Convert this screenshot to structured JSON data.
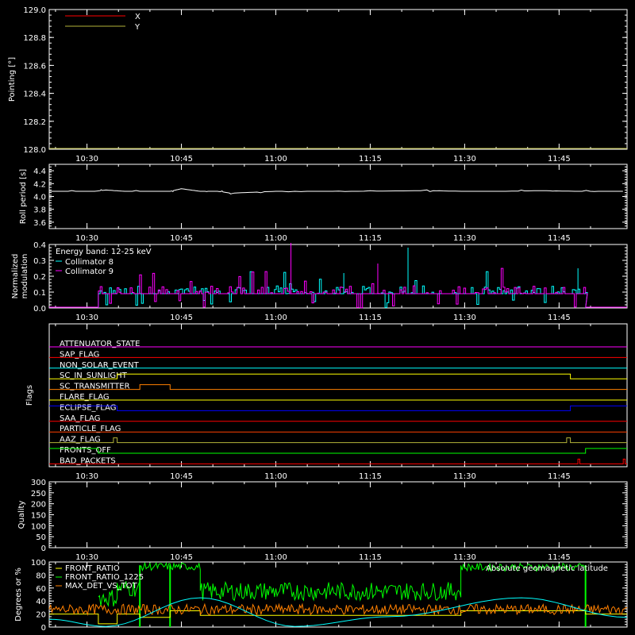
{
  "figure": {
    "background": "#000000",
    "axis_color": "#ffffff",
    "time_ticks": [
      "10:30",
      "10:45",
      "11:00",
      "11:15",
      "11:30",
      "11:45"
    ],
    "time_range_minutes": [
      10.4,
      11.93
    ],
    "time_tick_positions": [
      10.5,
      10.75,
      11.0,
      11.25,
      11.5,
      11.75
    ]
  },
  "chart_data": [
    {
      "id": "pointing",
      "type": "line",
      "ylabel": "Pointing [°]",
      "ylim": [
        128.0,
        129.0
      ],
      "yticks": [
        "128.0",
        "128.2",
        "128.4",
        "128.6",
        "128.8",
        "129.0"
      ],
      "ytick_values": [
        128.0,
        128.2,
        128.4,
        128.6,
        128.8,
        129.0
      ],
      "legend": [
        {
          "label": "X",
          "color": "#ff0000"
        },
        {
          "label": "Y",
          "color": "#b5b53a"
        }
      ],
      "series": [
        {
          "name": "X",
          "color": "#ff0000",
          "x": [
            10.4,
            11.93
          ],
          "y": [
            null,
            null
          ]
        },
        {
          "name": "Y",
          "color": "#b5b53a",
          "x": [
            10.4,
            11.93
          ],
          "y": [
            128.0,
            128.0
          ]
        }
      ]
    },
    {
      "id": "roll",
      "type": "line",
      "ylabel": "Roll period [s]",
      "ylim": [
        3.5,
        4.5
      ],
      "yticks": [
        "3.6",
        "3.8",
        "4.0",
        "4.2",
        "4.4"
      ],
      "ytick_values": [
        3.6,
        3.8,
        4.0,
        4.2,
        4.4
      ],
      "series": [
        {
          "name": "",
          "color": "#ffffff",
          "x": [
            10.4,
            10.52,
            10.55,
            10.6,
            10.72,
            10.75,
            10.8,
            10.85,
            10.88,
            11.0,
            11.2,
            11.4,
            11.5,
            11.6,
            11.7,
            11.8,
            11.93
          ],
          "y": [
            4.08,
            4.08,
            4.1,
            4.08,
            4.08,
            4.12,
            4.08,
            4.08,
            4.05,
            4.08,
            4.08,
            4.09,
            4.08,
            4.08,
            4.09,
            4.08,
            4.08
          ]
        }
      ]
    },
    {
      "id": "modulation",
      "type": "line",
      "ylabel": "Normalized modulation",
      "ylim": [
        0.0,
        0.4
      ],
      "yticks": [
        "0.0",
        "0.1",
        "0.2",
        "0.3",
        "0.4"
      ],
      "ytick_values": [
        0.0,
        0.1,
        0.2,
        0.3,
        0.4
      ],
      "annotation": "Energy band: 12-25 keV",
      "legend": [
        {
          "label": "Collimator 8",
          "color": "#00ffff"
        },
        {
          "label": "Collimator 9",
          "color": "#ff00ff"
        }
      ],
      "active_range": [
        10.53,
        11.82
      ],
      "baseline": 0.09,
      "series": [
        {
          "name": "Collimator 8",
          "color": "#00ffff"
        },
        {
          "name": "Collimator 9",
          "color": "#ff00ff"
        }
      ]
    },
    {
      "id": "flags",
      "type": "line",
      "ylabel": "Flags",
      "flags": [
        {
          "label": "ATTENUATOR_STATE",
          "color": "#ff00ff",
          "transitions": []
        },
        {
          "label": "SAP_FLAG",
          "color": "#ff0000",
          "transitions": []
        },
        {
          "label": "NON_SOLAR_EVENT",
          "color": "#00ffff",
          "transitions": []
        },
        {
          "label": "SC_IN_SUNLIGHT",
          "color": "#ffff00",
          "transitions": [
            [
              10.4,
              0
            ],
            [
              10.58,
              1
            ],
            [
              11.78,
              0
            ]
          ]
        },
        {
          "label": "SC_TRANSMITTER",
          "color": "#ff8000",
          "transitions": [
            [
              10.4,
              0
            ],
            [
              10.64,
              1
            ],
            [
              10.72,
              0
            ]
          ]
        },
        {
          "label": "FLARE_FLAG",
          "color": "#ffff00",
          "transitions": []
        },
        {
          "label": "ECLIPSE_FLAG",
          "color": "#0000ff",
          "transitions": [
            [
              10.4,
              1
            ],
            [
              10.58,
              0
            ],
            [
              11.78,
              1
            ]
          ]
        },
        {
          "label": "SAA_FLAG",
          "color": "#ff0000",
          "transitions": []
        },
        {
          "label": "PARTICLE_FLAG",
          "color": "#ff4000",
          "transitions": []
        },
        {
          "label": "AAZ_FLAG",
          "color": "#b5b53a",
          "transitions": [
            [
              10.4,
              0
            ],
            [
              10.57,
              1
            ],
            [
              10.58,
              0
            ],
            [
              11.77,
              1
            ],
            [
              11.78,
              0
            ]
          ]
        },
        {
          "label": "FRONTS_OFF",
          "color": "#00ff00",
          "transitions": [
            [
              10.4,
              1
            ],
            [
              10.53,
              0
            ],
            [
              11.82,
              1
            ]
          ]
        },
        {
          "label": "BAD_PACKETS",
          "color": "#ff0000",
          "transitions": [
            [
              10.4,
              0
            ],
            [
              11.8,
              1
            ],
            [
              11.805,
              0
            ],
            [
              11.92,
              1
            ],
            [
              11.925,
              0
            ]
          ]
        }
      ]
    },
    {
      "id": "quality",
      "type": "line",
      "ylabel": "Quality",
      "ylim": [
        0,
        300
      ],
      "yticks": [
        "0",
        "50",
        "100",
        "150",
        "200",
        "250",
        "300"
      ],
      "ytick_values": [
        0,
        50,
        100,
        150,
        200,
        250,
        300
      ],
      "series": [
        {
          "name": "",
          "color": "#ffffff",
          "x": [
            10.4,
            11.93
          ],
          "y": [
            0,
            0
          ]
        }
      ]
    },
    {
      "id": "ratios",
      "type": "line",
      "ylabel": "Degrees or %",
      "ylim": [
        0,
        100
      ],
      "yticks": [
        "0",
        "20",
        "40",
        "60",
        "80",
        "100"
      ],
      "ytick_values": [
        0,
        20,
        40,
        60,
        80,
        100
      ],
      "legend": [
        {
          "label": "FRONT_RATIO",
          "color": "#ffff00"
        },
        {
          "label": "FRONT_RATIO_1225",
          "color": "#00ff00"
        },
        {
          "label": "MAX_DET_VS_TOT",
          "color": "#ff8000"
        }
      ],
      "legend_right": {
        "label": "Absolute geomagnetic latitude",
        "color": "#00ffff"
      },
      "series": [
        {
          "name": "FRONT_RATIO",
          "color": "#ffff00",
          "x": [
            10.4,
            10.53,
            10.53,
            10.58,
            10.58,
            10.64,
            10.64,
            10.72,
            10.72,
            10.8,
            10.8,
            11.49,
            11.49,
            11.82,
            11.82,
            11.93
          ],
          "y": [
            20,
            20,
            5,
            5,
            20,
            20,
            15,
            15,
            25,
            25,
            18,
            18,
            25,
            25,
            20,
            20
          ]
        },
        {
          "name": "FRONT_RATIO_1225",
          "color": "#00ff00",
          "segments": [
            {
              "x": [
                10.53,
                10.58
              ],
              "mean": 45
            },
            {
              "x": [
                10.58,
                10.64
              ],
              "mean": 60
            },
            {
              "x": [
                10.64,
                10.8
              ],
              "mean": 93
            },
            {
              "x": [
                10.8,
                11.49
              ],
              "mean": 55
            },
            {
              "x": [
                11.49,
                11.82
              ],
              "mean": 92
            }
          ],
          "drops": [
            10.64,
            10.72,
            11.82
          ]
        },
        {
          "name": "MAX_DET_VS_TOT",
          "color": "#ff8000",
          "mean": 27,
          "jitter": 8
        },
        {
          "name": "Absolute geomagnetic latitude",
          "color": "#00ffff",
          "x": [
            10.4,
            10.55,
            10.8,
            11.05,
            11.3,
            11.65,
            11.93
          ],
          "y": [
            12,
            1,
            45,
            1,
            16,
            45,
            15
          ]
        }
      ]
    }
  ]
}
